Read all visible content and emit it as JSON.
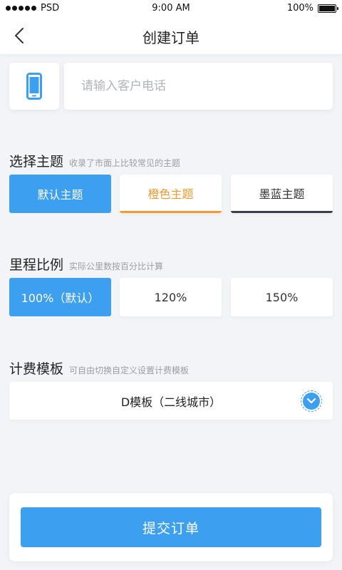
{
  "status_bar": {
    "carrier": "PSD",
    "time": "9:00 AM",
    "battery": "100%"
  },
  "nav": {
    "title": "创建订单"
  },
  "phone": {
    "placeholder": "请输入客户电话",
    "value": ""
  },
  "theme_section": {
    "title": "选择主题",
    "subtitle": "收录了市面上比较常见的主题",
    "options": [
      {
        "label": "默认主题",
        "state": "selected",
        "color": "#3d9ff0"
      },
      {
        "label": "橙色主题",
        "state": "unselected",
        "color": "#f29a2e"
      },
      {
        "label": "墨蓝主题",
        "state": "unselected",
        "color": "#3b3f48"
      }
    ]
  },
  "ratio_section": {
    "title": "里程比例",
    "subtitle": "实际公里数按百分比计算",
    "options": [
      {
        "label": "100%（默认）",
        "state": "selected"
      },
      {
        "label": "120%",
        "state": "unselected"
      },
      {
        "label": "150%",
        "state": "unselected"
      }
    ]
  },
  "template_section": {
    "title": "计费模板",
    "subtitle": "可自由切换自定义设置计费模板",
    "selected": "D模板（二线城市）"
  },
  "submit": {
    "label": "提交订单"
  },
  "colors": {
    "primary": "#3d9ff0",
    "orange": "#f29a2e",
    "navy": "#3b3f48",
    "background": "#f2f4f7"
  },
  "icons": {
    "back": "chevron-left-icon",
    "phone": "mobile-phone-icon",
    "dropdown": "chevron-down-icon"
  }
}
